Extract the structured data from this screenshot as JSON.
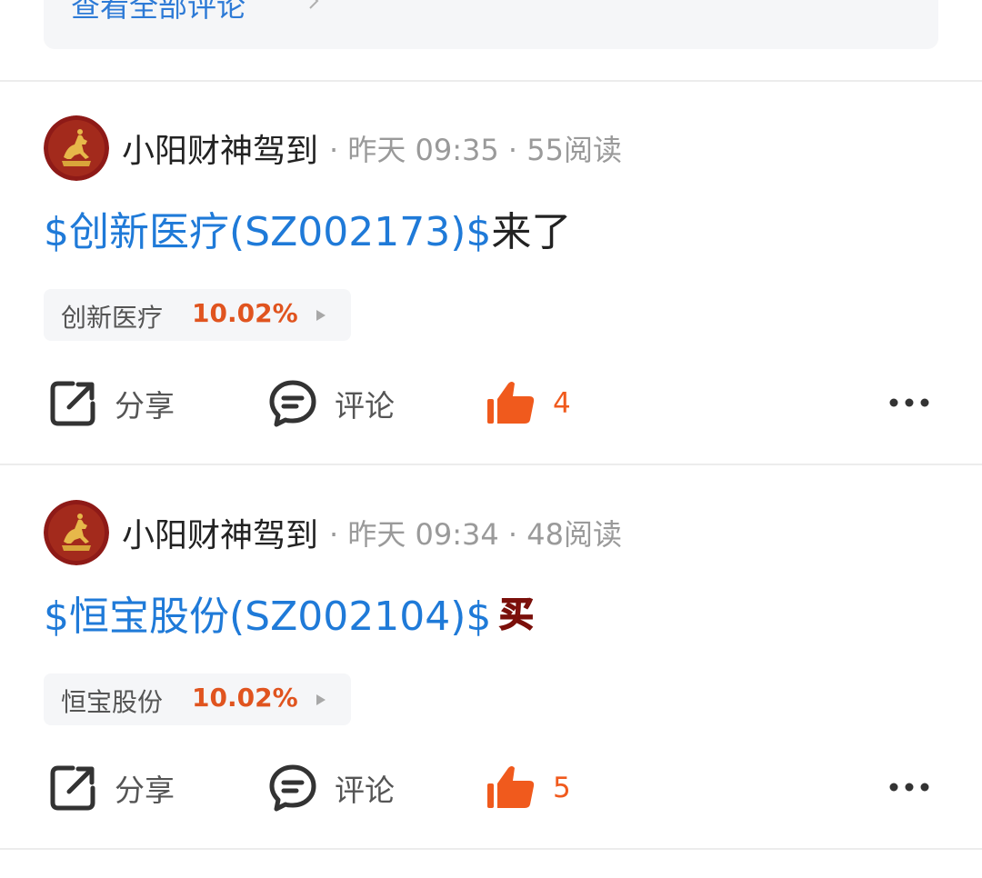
{
  "prev_post": {
    "view_all_label": "查看全部评论"
  },
  "posts": [
    {
      "author": "小阳财神驾到",
      "meta": "· 昨天 09:35 · 55阅读",
      "stock_link": "$创新医疗(SZ002173)$",
      "text_after": "来了",
      "emoji": "",
      "chip": {
        "name": "创新医疗",
        "change": "10.02%"
      },
      "actions": {
        "share": "分享",
        "comment": "评论",
        "likes": "4"
      }
    },
    {
      "author": "小阳财神驾到",
      "meta": "· 昨天 09:34 · 48阅读",
      "stock_link": "$恒宝股份(SZ002104)$",
      "text_after": "",
      "emoji": "买",
      "chip": {
        "name": "恒宝股份",
        "change": "10.02%"
      },
      "actions": {
        "share": "分享",
        "comment": "评论",
        "likes": "5"
      }
    }
  ],
  "colors": {
    "link": "#1f7ad8",
    "up": "#e0541f",
    "like": "#f05a1d",
    "chip_bg": "#f5f6f8"
  }
}
